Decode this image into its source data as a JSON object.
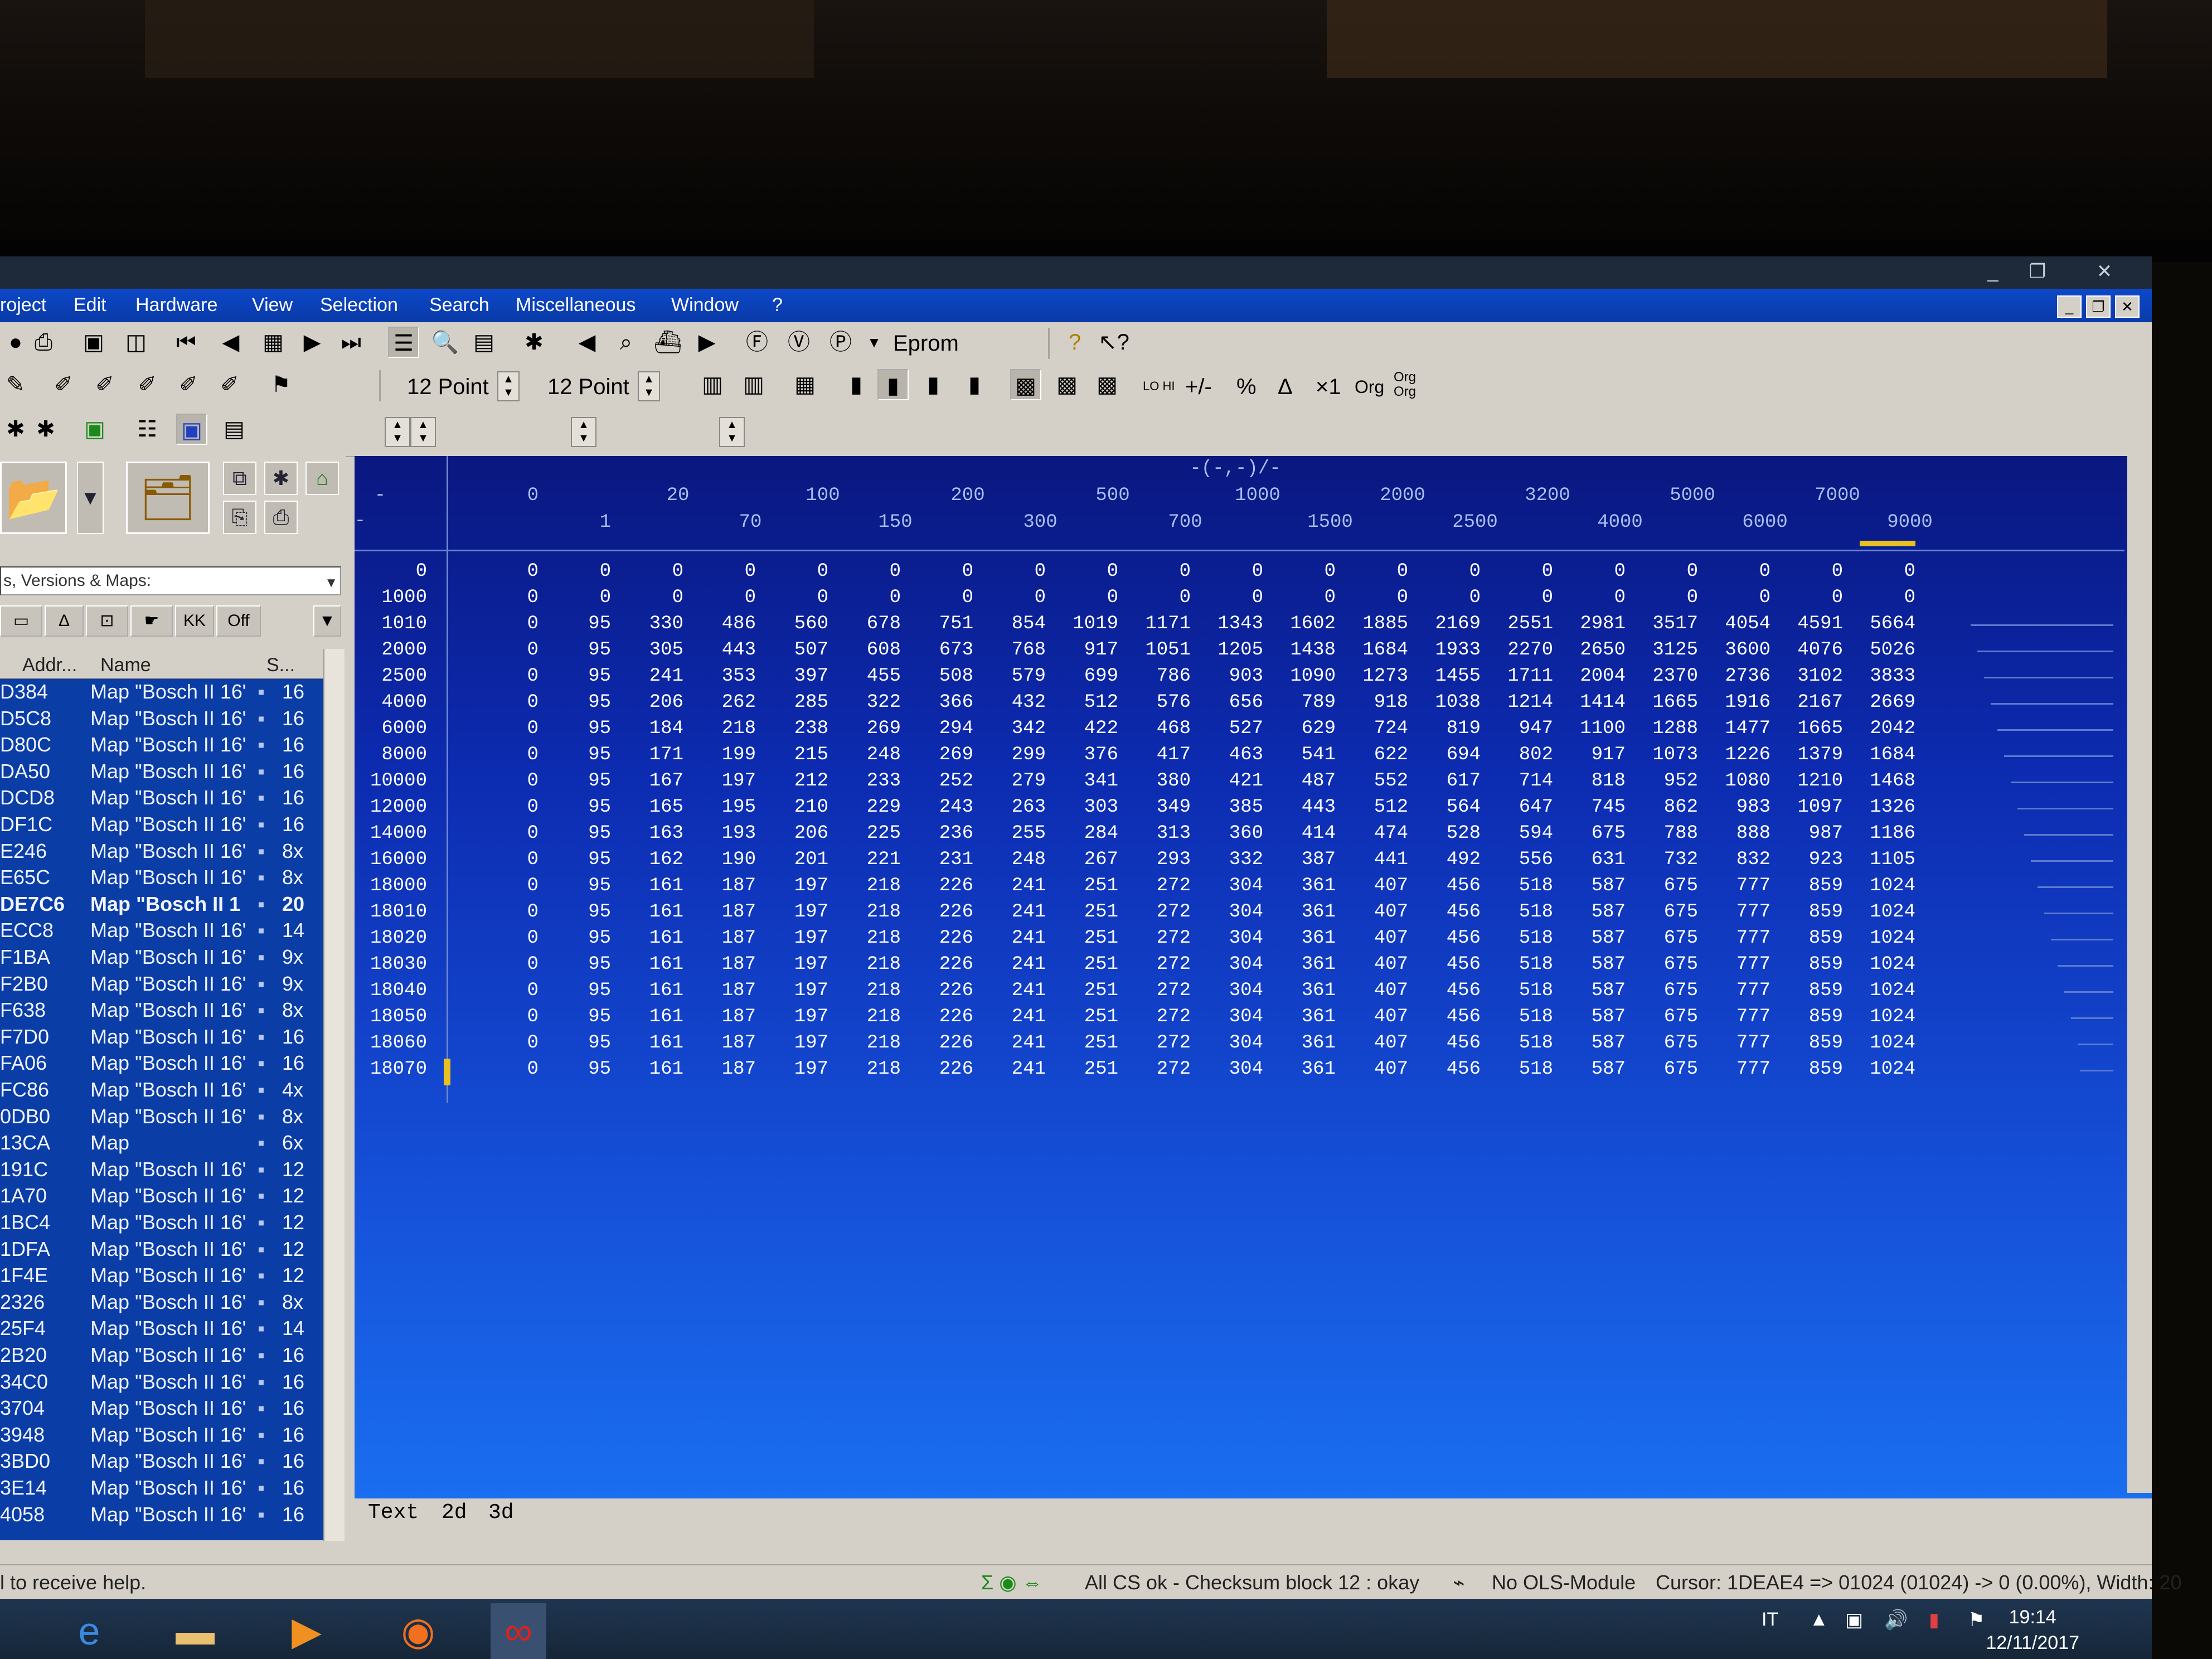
{
  "menubar": {
    "items": [
      "roject",
      "Edit",
      "Hardware",
      "View",
      "Selection",
      "Search",
      "Miscellaneous",
      "Window",
      "?"
    ]
  },
  "toolbar": {
    "eprom_label": "Eprom",
    "font_size_1": "12 Point",
    "font_size_2": "12 Point",
    "percent": "%",
    "delta": "Δ",
    "times_one": "×1",
    "org": "Org",
    "org_org": "Org\nOrg",
    "plus_minus": "+/-",
    "lo_hi": "LO HI"
  },
  "leftpanel": {
    "combo_value": "s, Versions & Maps:",
    "filter_buttons": [
      "KK",
      "Off"
    ],
    "columns": {
      "addr": "Addr...",
      "name": "Name",
      "size": "S..."
    },
    "rows": [
      {
        "addr": "D384",
        "name": "Map \"Bosch II 16\"",
        "size": "16"
      },
      {
        "addr": "D5C8",
        "name": "Map \"Bosch II 16\"",
        "size": "16"
      },
      {
        "addr": "D80C",
        "name": "Map \"Bosch II 16\"",
        "size": "16"
      },
      {
        "addr": "DA50",
        "name": "Map \"Bosch II 16\"",
        "size": "16"
      },
      {
        "addr": "DCD8",
        "name": "Map \"Bosch II 16\"",
        "size": "16"
      },
      {
        "addr": "DF1C",
        "name": "Map \"Bosch II 16\"",
        "size": "16"
      },
      {
        "addr": "E246",
        "name": "Map \"Bosch II 16\"",
        "size": "8x"
      },
      {
        "addr": "E65C",
        "name": "Map \"Bosch II 16\"",
        "size": "8x"
      },
      {
        "addr": "DE7C6",
        "name": "Map \"Bosch II 1",
        "size": "20",
        "bold": true
      },
      {
        "addr": "ECC8",
        "name": "Map \"Bosch II 16\"",
        "size": "14"
      },
      {
        "addr": "F1BA",
        "name": "Map \"Bosch II 16\"",
        "size": "9x"
      },
      {
        "addr": "F2B0",
        "name": "Map \"Bosch II 16\"",
        "size": "9x"
      },
      {
        "addr": "F638",
        "name": "Map \"Bosch II 16\"",
        "size": "8x"
      },
      {
        "addr": "F7D0",
        "name": "Map \"Bosch II 16\"",
        "size": "16"
      },
      {
        "addr": "FA06",
        "name": "Map \"Bosch II 16\"",
        "size": "16"
      },
      {
        "addr": "FC86",
        "name": "Map \"Bosch II 16\"",
        "size": "4x"
      },
      {
        "addr": "0DB0",
        "name": "Map \"Bosch II 16\"",
        "size": "8x"
      },
      {
        "addr": "13CA",
        "name": "Map",
        "size": "6x"
      },
      {
        "addr": "191C",
        "name": "Map \"Bosch II 16\"",
        "size": "12"
      },
      {
        "addr": "1A70",
        "name": "Map \"Bosch II 16\"",
        "size": "12"
      },
      {
        "addr": "1BC4",
        "name": "Map \"Bosch II 16\"",
        "size": "12"
      },
      {
        "addr": "1DFA",
        "name": "Map \"Bosch II 16\"",
        "size": "12"
      },
      {
        "addr": "1F4E",
        "name": "Map \"Bosch II 16\"",
        "size": "12"
      },
      {
        "addr": "2326",
        "name": "Map \"Bosch II 16\"",
        "size": "8x"
      },
      {
        "addr": "25F4",
        "name": "Map \"Bosch II 16\"",
        "size": "14"
      },
      {
        "addr": "2B20",
        "name": "Map \"Bosch II 16\"",
        "size": "16"
      },
      {
        "addr": "34C0",
        "name": "Map \"Bosch II 16\"",
        "size": "16"
      },
      {
        "addr": "3704",
        "name": "Map \"Bosch II 16\"",
        "size": "16"
      },
      {
        "addr": "3948",
        "name": "Map \"Bosch II 16\"",
        "size": "16"
      },
      {
        "addr": "3BD0",
        "name": "Map \"Bosch II 16\"",
        "size": "16"
      },
      {
        "addr": "3E14",
        "name": "Map \"Bosch II 16\"",
        "size": "16"
      },
      {
        "addr": "4058",
        "name": "Map \"Bosch II 16\"",
        "size": "16"
      }
    ]
  },
  "mapview": {
    "axis_title": "-(-,-)/-",
    "corner": "-",
    "corner2": "-",
    "top_header_upper": [
      "0",
      "20",
      "100",
      "200",
      "500",
      "1000",
      "2000",
      "3200",
      "5000",
      "7000"
    ],
    "top_header_lower": [
      "1",
      "70",
      "150",
      "300",
      "700",
      "1500",
      "2500",
      "4000",
      "6000",
      "9000"
    ],
    "row_labels": [
      "0",
      "1000",
      "1010",
      "2000",
      "2500",
      "4000",
      "6000",
      "8000",
      "10000",
      "12000",
      "14000",
      "16000",
      "18000",
      "18010",
      "18020",
      "18030",
      "18040",
      "18050",
      "18060",
      "18070"
    ],
    "cells": [
      [
        "0",
        "0",
        "0",
        "0",
        "0",
        "0",
        "0",
        "0",
        "0",
        "0",
        "0",
        "0",
        "0",
        "0",
        "0",
        "0",
        "0",
        "0",
        "0",
        "0"
      ],
      [
        "0",
        "0",
        "0",
        "0",
        "0",
        "0",
        "0",
        "0",
        "0",
        "0",
        "0",
        "0",
        "0",
        "0",
        "0",
        "0",
        "0",
        "0",
        "0",
        "0"
      ],
      [
        "0",
        "95",
        "330",
        "486",
        "560",
        "678",
        "751",
        "854",
        "1019",
        "1171",
        "1343",
        "1602",
        "1885",
        "2169",
        "2551",
        "2981",
        "3517",
        "4054",
        "4591",
        "5664"
      ],
      [
        "0",
        "95",
        "305",
        "443",
        "507",
        "608",
        "673",
        "768",
        "917",
        "1051",
        "1205",
        "1438",
        "1684",
        "1933",
        "2270",
        "2650",
        "3125",
        "3600",
        "4076",
        "5026"
      ],
      [
        "0",
        "95",
        "241",
        "353",
        "397",
        "455",
        "508",
        "579",
        "699",
        "786",
        "903",
        "1090",
        "1273",
        "1455",
        "1711",
        "2004",
        "2370",
        "2736",
        "3102",
        "3833"
      ],
      [
        "0",
        "95",
        "206",
        "262",
        "285",
        "322",
        "366",
        "432",
        "512",
        "576",
        "656",
        "789",
        "918",
        "1038",
        "1214",
        "1414",
        "1665",
        "1916",
        "2167",
        "2669"
      ],
      [
        "0",
        "95",
        "184",
        "218",
        "238",
        "269",
        "294",
        "342",
        "422",
        "468",
        "527",
        "629",
        "724",
        "819",
        "947",
        "1100",
        "1288",
        "1477",
        "1665",
        "2042"
      ],
      [
        "0",
        "95",
        "171",
        "199",
        "215",
        "248",
        "269",
        "299",
        "376",
        "417",
        "463",
        "541",
        "622",
        "694",
        "802",
        "917",
        "1073",
        "1226",
        "1379",
        "1684"
      ],
      [
        "0",
        "95",
        "167",
        "197",
        "212",
        "233",
        "252",
        "279",
        "341",
        "380",
        "421",
        "487",
        "552",
        "617",
        "714",
        "818",
        "952",
        "1080",
        "1210",
        "1468"
      ],
      [
        "0",
        "95",
        "165",
        "195",
        "210",
        "229",
        "243",
        "263",
        "303",
        "349",
        "385",
        "443",
        "512",
        "564",
        "647",
        "745",
        "862",
        "983",
        "1097",
        "1326"
      ],
      [
        "0",
        "95",
        "163",
        "193",
        "206",
        "225",
        "236",
        "255",
        "284",
        "313",
        "360",
        "414",
        "474",
        "528",
        "594",
        "675",
        "788",
        "888",
        "987",
        "1186"
      ],
      [
        "0",
        "95",
        "162",
        "190",
        "201",
        "221",
        "231",
        "248",
        "267",
        "293",
        "332",
        "387",
        "441",
        "492",
        "556",
        "631",
        "732",
        "832",
        "923",
        "1105"
      ],
      [
        "0",
        "95",
        "161",
        "187",
        "197",
        "218",
        "226",
        "241",
        "251",
        "272",
        "304",
        "361",
        "407",
        "456",
        "518",
        "587",
        "675",
        "777",
        "859",
        "1024"
      ],
      [
        "0",
        "95",
        "161",
        "187",
        "197",
        "218",
        "226",
        "241",
        "251",
        "272",
        "304",
        "361",
        "407",
        "456",
        "518",
        "587",
        "675",
        "777",
        "859",
        "1024"
      ],
      [
        "0",
        "95",
        "161",
        "187",
        "197",
        "218",
        "226",
        "241",
        "251",
        "272",
        "304",
        "361",
        "407",
        "456",
        "518",
        "587",
        "675",
        "777",
        "859",
        "1024"
      ],
      [
        "0",
        "95",
        "161",
        "187",
        "197",
        "218",
        "226",
        "241",
        "251",
        "272",
        "304",
        "361",
        "407",
        "456",
        "518",
        "587",
        "675",
        "777",
        "859",
        "1024"
      ],
      [
        "0",
        "95",
        "161",
        "187",
        "197",
        "218",
        "226",
        "241",
        "251",
        "272",
        "304",
        "361",
        "407",
        "456",
        "518",
        "587",
        "675",
        "777",
        "859",
        "1024"
      ],
      [
        "0",
        "95",
        "161",
        "187",
        "197",
        "218",
        "226",
        "241",
        "251",
        "272",
        "304",
        "361",
        "407",
        "456",
        "518",
        "587",
        "675",
        "777",
        "859",
        "1024"
      ],
      [
        "0",
        "95",
        "161",
        "187",
        "197",
        "218",
        "226",
        "241",
        "251",
        "272",
        "304",
        "361",
        "407",
        "456",
        "518",
        "587",
        "675",
        "777",
        "859",
        "1024"
      ],
      [
        "0",
        "95",
        "161",
        "187",
        "197",
        "218",
        "226",
        "241",
        "251",
        "272",
        "304",
        "361",
        "407",
        "456",
        "518",
        "587",
        "675",
        "777",
        "859",
        "1024"
      ]
    ],
    "tabs": [
      "Text",
      "2d",
      "3d"
    ]
  },
  "statusbar": {
    "help": "l to receive help.",
    "checksum": "All CS ok - Checksum block 12 : okay",
    "module": "No OLS-Module",
    "cursor": "Cursor: 1DEAE4 => 01024 (01024) -> 0 (0.00%), Width: 20"
  },
  "taskbar": {
    "lang": "IT",
    "time": "19:14",
    "date": "12/11/2017"
  },
  "colors": {
    "map_bg_top": "#0a1780",
    "map_bg_bottom": "#1a6ef0",
    "menubar": "#0c48c8",
    "cursor": "#e8c020"
  }
}
